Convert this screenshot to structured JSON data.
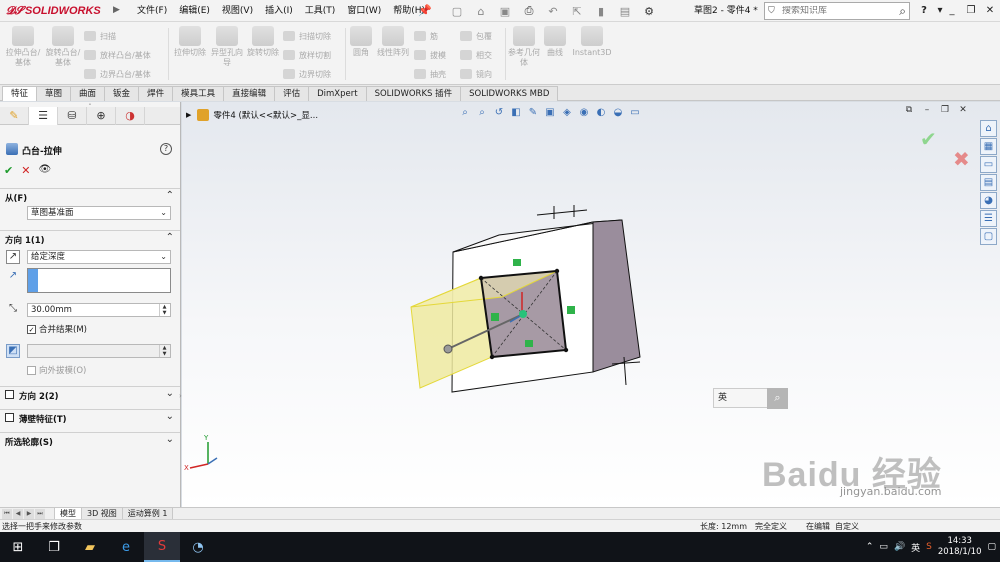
{
  "app": {
    "logo_text": "SOLIDWORKS",
    "menus": [
      "文件(F)",
      "编辑(E)",
      "视图(V)",
      "插入(I)",
      "工具(T)",
      "窗口(W)",
      "帮助(H)"
    ],
    "doc_title": "草图2 - 零件4 *",
    "search_placeholder": "搜索知识库",
    "help_label": "?"
  },
  "commands": {
    "big": [
      "拉伸凸台/基体",
      "旋转凸台/基体",
      "拉伸切除",
      "异型孔向导",
      "旋转切除",
      "圆角",
      "线性阵列",
      "参考几何体",
      "曲线",
      "Instant3D"
    ],
    "small": [
      "扫描",
      "放样凸台/基体",
      "边界凸台/基体",
      "扫描切除",
      "放样切割",
      "边界切除",
      "筋",
      "拔模",
      "抽壳",
      "包覆",
      "相交",
      "镜向"
    ]
  },
  "tabs": [
    "特征",
    "草图",
    "曲面",
    "钣金",
    "焊件",
    "模具工具",
    "直接编辑",
    "评估",
    "DimXpert",
    "SOLIDWORKS 插件",
    "SOLIDWORKS MBD"
  ],
  "active_tab": "特征",
  "property_manager": {
    "title": "凸台-拉伸",
    "from_label": "从(F)",
    "from_value": "草图基准面",
    "direction1_label": "方向 1(1)",
    "end_condition": "给定深度",
    "depth_value": "30.00mm",
    "merge_result_label": "合并结果(M)",
    "merge_result_checked": true,
    "draft_outward_label": "向外拔模(O)",
    "direction2_label": "方向 2(2)",
    "thin_feature_label": "薄壁特征(T)",
    "selected_contours_label": "所选轮廓(S)"
  },
  "viewport": {
    "breadcrumb": "零件4  (默认<<默认>_显..."
  },
  "bottom_tabs": [
    "模型",
    "3D 视图",
    "运动算例 1"
  ],
  "active_bottom_tab": "模型",
  "status": {
    "message": "选择一把手来修改参数",
    "length": "长度: 12mm",
    "state": "完全定义",
    "editing": "在编辑",
    "units": "自定义"
  },
  "watermark": {
    "logo": "Baidu 经验",
    "url": "jingyan.baidu.com",
    "search_label": "英"
  },
  "taskbar": {
    "time": "14:33",
    "date": "2018/1/10",
    "ime": "英"
  },
  "colors": {
    "brand": "#c8102e",
    "accent": "#3a6fb5",
    "preview_yellow": "#efeaa0",
    "box_shade": "#9a8d9c"
  }
}
